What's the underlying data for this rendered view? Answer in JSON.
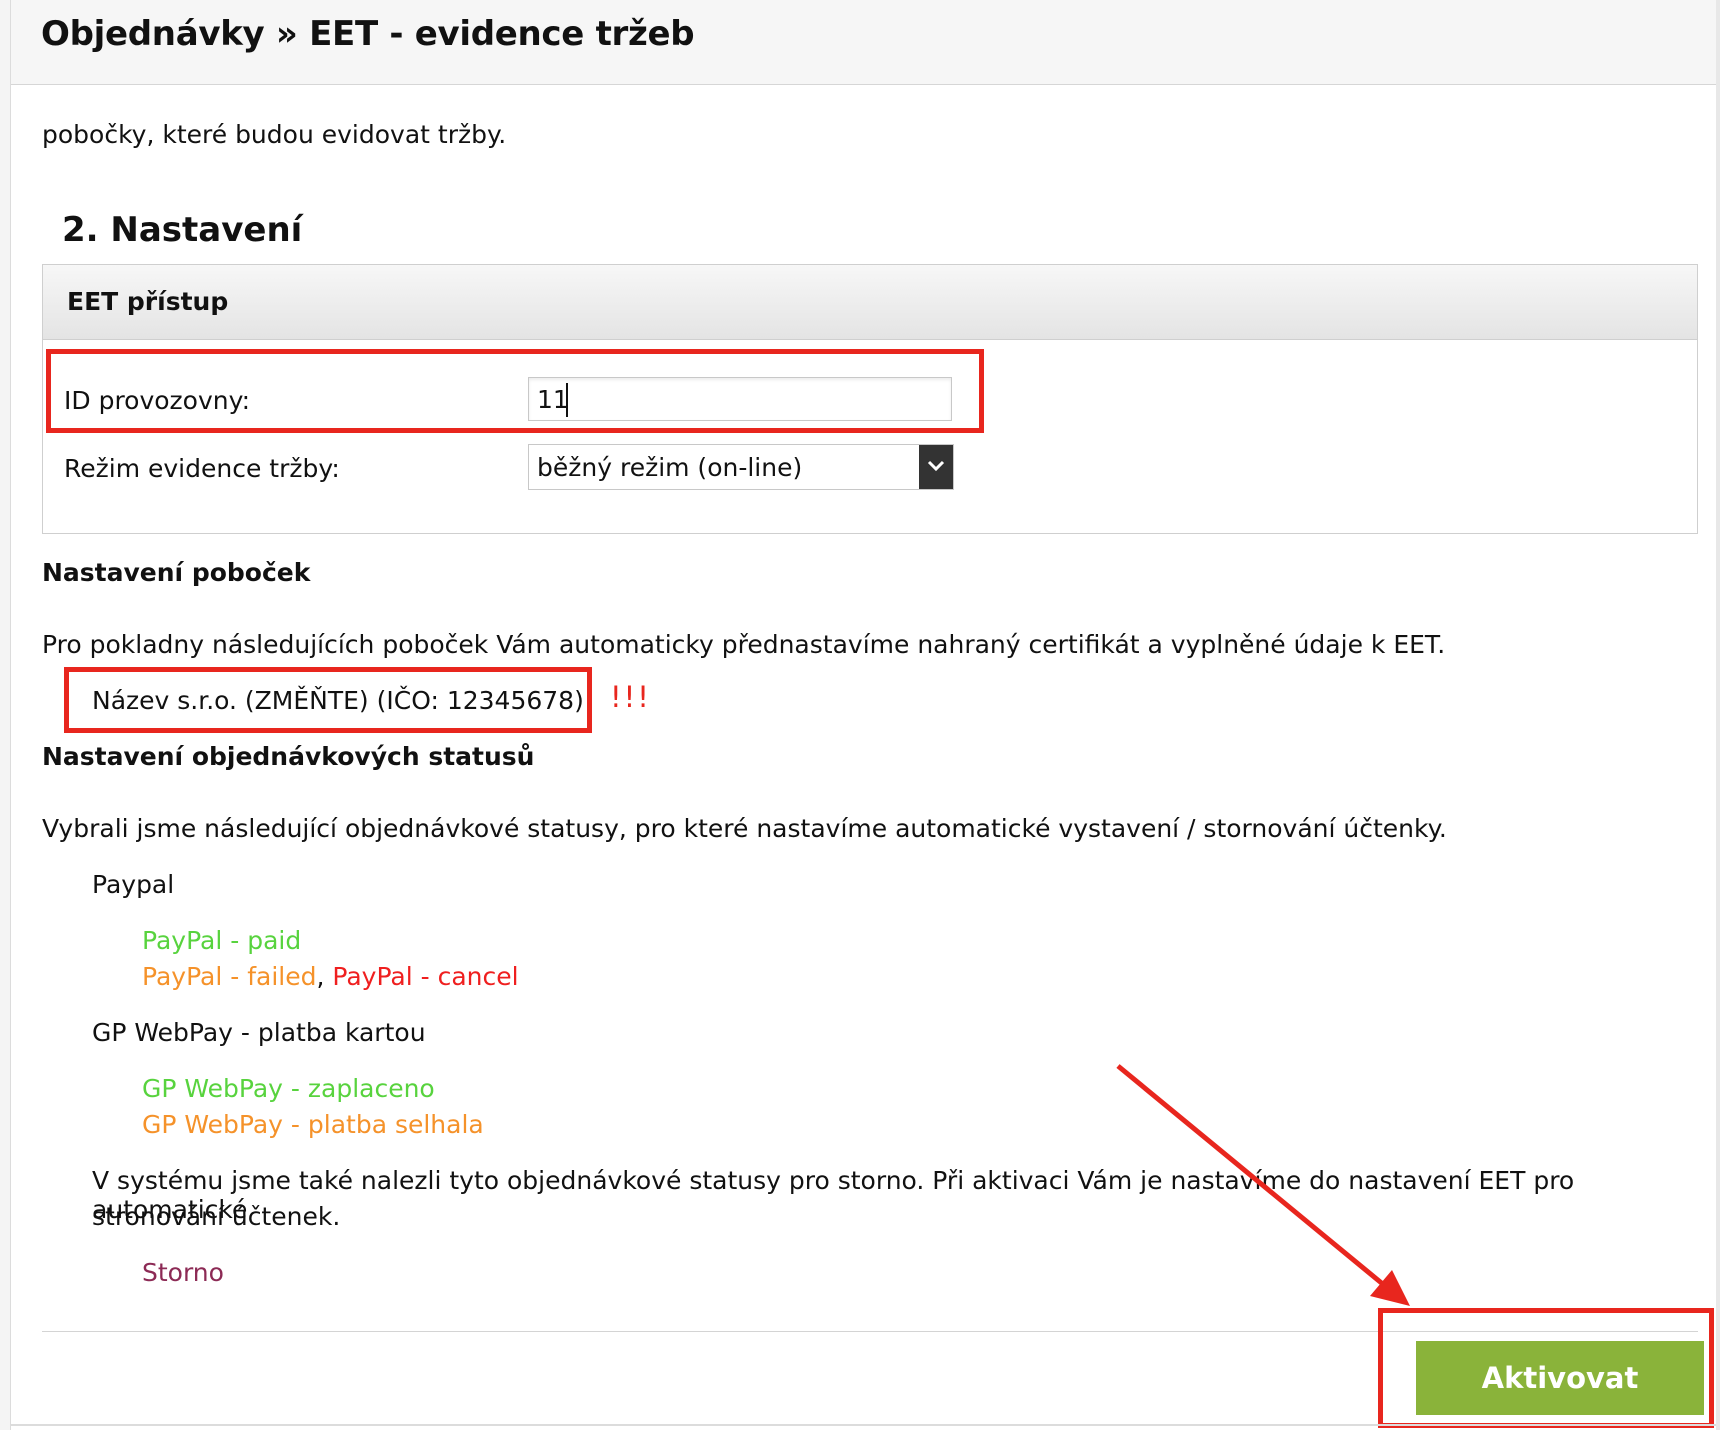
{
  "header": {
    "title": "Objednávky » EET - evidence tržeb"
  },
  "intro_text": "pobočky, které budou evidovat tržby.",
  "settings": {
    "section_title": "2. Nastavení",
    "panel_title": "EET přístup",
    "id_label": "ID provozovny:",
    "id_value": "11",
    "mode_label": "Režim evidence tržby:",
    "mode_value": "běžný režim (on-line)"
  },
  "branches": {
    "heading": "Nastavení poboček",
    "description": "Pro pokladny následujících poboček Vám automaticky přednastavíme nahraný certifikát a vyplněné údaje k EET.",
    "item": "Název s.r.o. (ZMĚŇTE) (IČO: 12345678)",
    "warning": "!!!"
  },
  "statuses": {
    "heading": "Nastavení objednávkových statusů",
    "description": "Vybrali jsme následující objednávkové statusy, pro které nastavíme automatické vystavení / stornování účtenky.",
    "paypal": {
      "name": "Paypal",
      "paid": "PayPal - paid",
      "failed": "PayPal - failed",
      "separator": ",",
      "cancel": "PayPal - cancel"
    },
    "gpwebpay": {
      "name": "GP WebPay - platba kartou",
      "paid": "GP WebPay - zaplaceno",
      "failed": "GP WebPay - platba selhala"
    },
    "storno_note_line1": "V systému jsme také nalezli tyto objednávkové statusy pro storno. Při aktivaci Vám je nastavíme do nastavení EET pro automatické",
    "storno_note_line2": "stronování účtenek.",
    "storno": "Storno"
  },
  "actions": {
    "activate": "Aktivovat"
  },
  "colors": {
    "annotation_red": "#e8261e",
    "status_paid": "#58d33e",
    "status_failed": "#f5922a",
    "status_cancel": "#ef1f1f",
    "status_storno": "#8c2a55",
    "activate_button": "#8ab33a"
  },
  "icons": {
    "select_arrow": "chevron-down-icon"
  }
}
